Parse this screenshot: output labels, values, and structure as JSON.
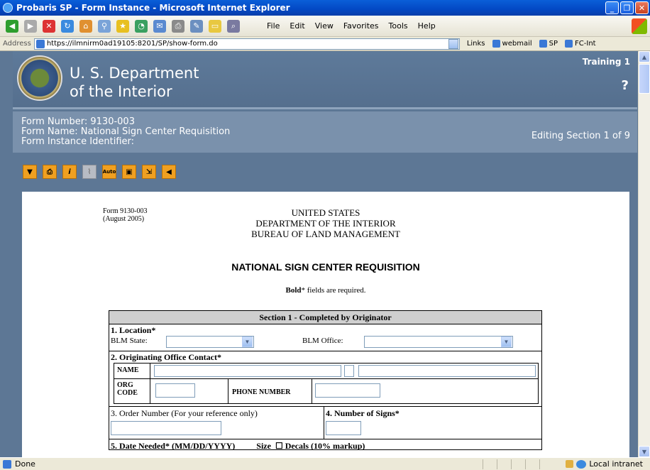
{
  "window": {
    "title": "Probaris SP - Form Instance - Microsoft Internet Explorer"
  },
  "menu": {
    "items": [
      "File",
      "Edit",
      "View",
      "Favorites",
      "Tools",
      "Help"
    ]
  },
  "address": {
    "label": "Address",
    "url": "https://ilmnirm0ad19105:8201/SP/show-form.do"
  },
  "links": {
    "label": "Links",
    "items": [
      "webmail",
      "SP",
      "FC-Int"
    ]
  },
  "header": {
    "line1": "U. S. Department",
    "line2": "of the Interior",
    "training": "Training 1",
    "help": "?"
  },
  "form_info": {
    "number": "Form Number: 9130-003",
    "name": "Form Name: National Sign Center Requisition",
    "identifier": "Form Instance Identifier:",
    "editing": "Editing Section 1 of 9"
  },
  "icons": {
    "auto_label": "Auto"
  },
  "document": {
    "form_no": "Form 9130-003",
    "form_date": "(August 2005)",
    "agency1": "UNITED STATES",
    "agency2": "DEPARTMENT OF THE INTERIOR",
    "agency3": "BUREAU OF LAND MANAGEMENT",
    "title": "NATIONAL SIGN CENTER REQUISITION",
    "required_bold": "Bold",
    "required_rest": "* fields are required."
  },
  "section1": {
    "heading": "Section 1 - Completed by Originator",
    "location_label": "1. Location*",
    "blm_state_label": "BLM State:",
    "blm_office_label": "BLM Office:",
    "contact_label": "2. Originating Office Contact*",
    "name_label": "NAME",
    "org_label_1": "ORG",
    "org_label_2": "CODE",
    "phone_label": "PHONE NUMBER",
    "order_label": "3. Order Number (For your reference only)",
    "signs_label": "4. Number of Signs*",
    "partial_row": "5. Date Needed* (MM/DD/YYYY)          Size  ☐ Decals (10% markup)"
  },
  "status": {
    "text": "Done",
    "zone": "Local intranet"
  }
}
